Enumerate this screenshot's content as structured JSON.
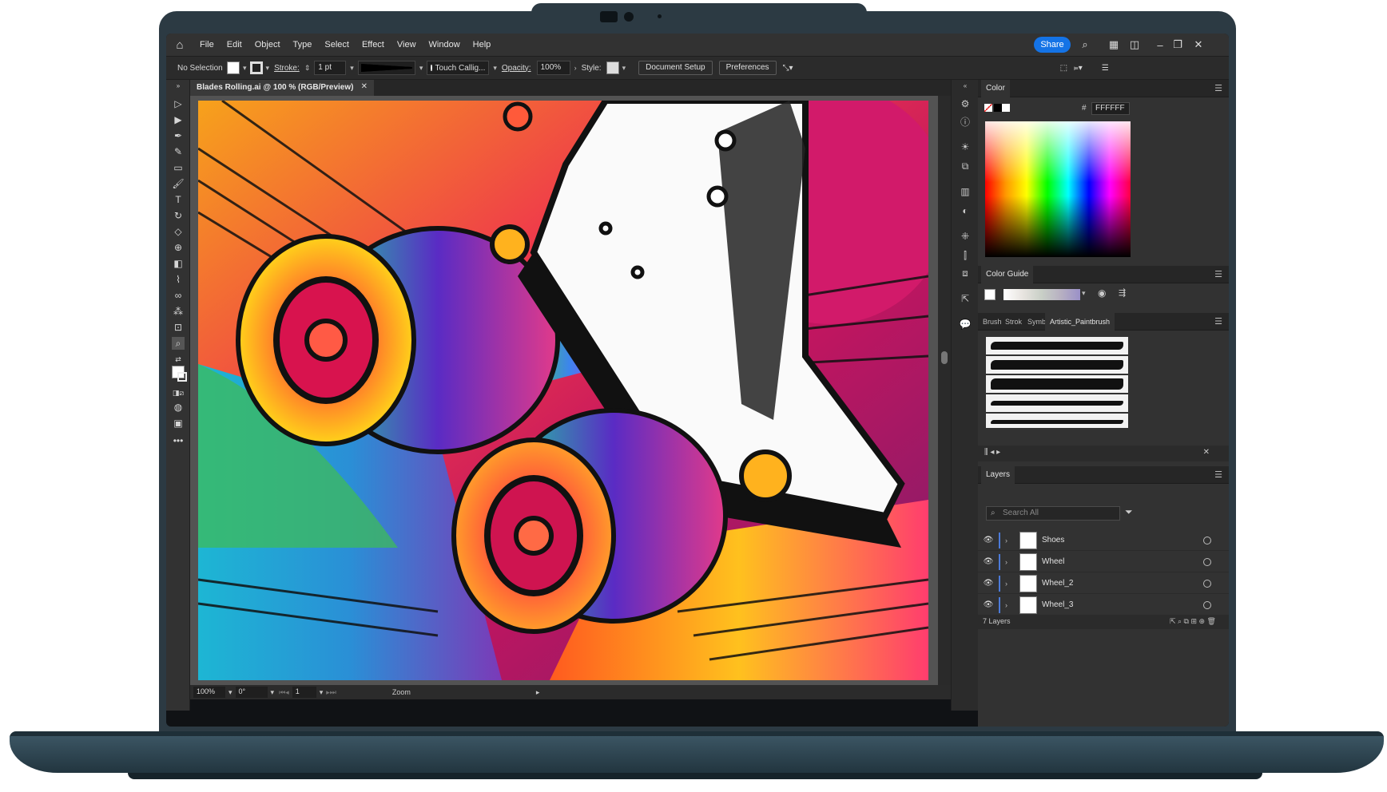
{
  "menubar": {
    "items": [
      "File",
      "Edit",
      "Object",
      "Type",
      "Select",
      "Effect",
      "View",
      "Window",
      "Help"
    ],
    "share_label": "Share"
  },
  "control": {
    "selection": "No Selection",
    "stroke_label": "Stroke:",
    "stroke_value": "1 pt",
    "brush_value": "Touch Callig...",
    "opacity_label": "Opacity:",
    "opacity_value": "100%",
    "style_label": "Style:",
    "document_setup": "Document Setup",
    "preferences": "Preferences"
  },
  "document": {
    "tab_title": "Blades Rolling.ai @ 100 % (RGB/Preview)",
    "zoom": "100%",
    "rotation": "0°",
    "artboard": "1",
    "status_mode": "Zoom"
  },
  "color_panel": {
    "title": "Color",
    "hash": "#",
    "hex": "FFFFFF"
  },
  "color_guide": {
    "title": "Color Guide"
  },
  "brushes": {
    "tabs": [
      "Brush",
      "Strok",
      "Symb",
      "Artistic_Paintbrush"
    ]
  },
  "layers": {
    "title": "Layers",
    "search_placeholder": "Search All",
    "items": [
      {
        "name": "Shoes"
      },
      {
        "name": "Wheel"
      },
      {
        "name": "Wheel_2"
      },
      {
        "name": "Wheel_3"
      }
    ],
    "count": "7 Layers"
  },
  "colors": {
    "accent": "#1473e6",
    "chrome": "#323232",
    "laptop": "#2c3a43"
  }
}
